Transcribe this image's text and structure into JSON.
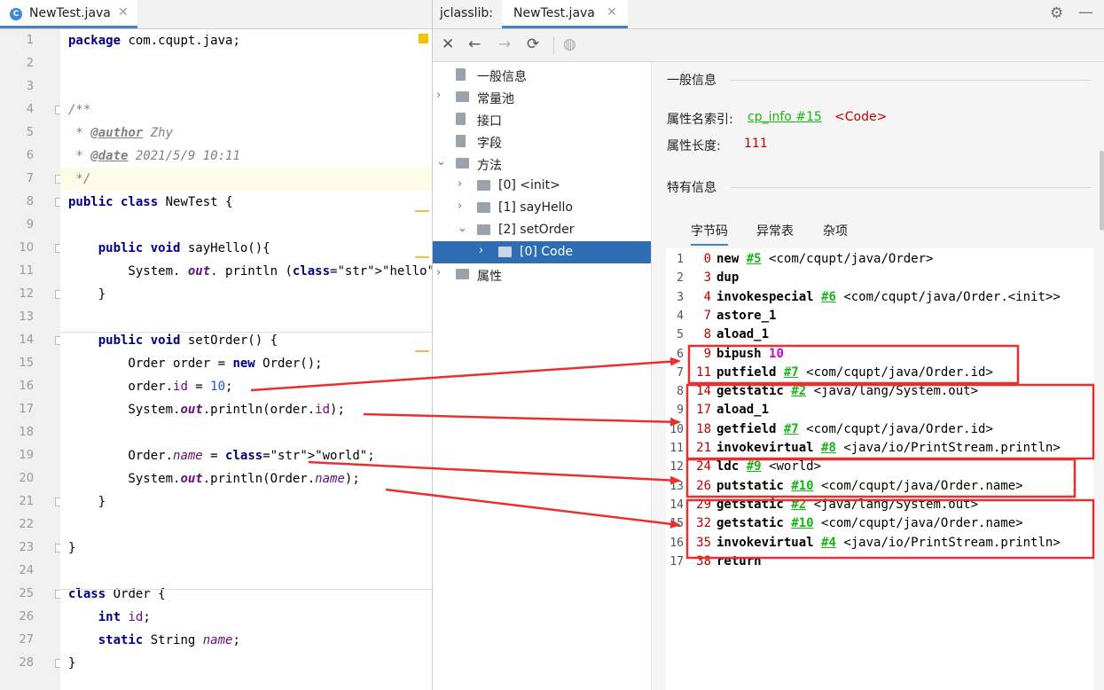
{
  "editor": {
    "tab_title": "NewTest.java",
    "tab_icon_letter": "C",
    "lines": [
      {
        "n": "1",
        "t": "package com.cqupt.java;"
      },
      {
        "n": "2",
        "t": ""
      },
      {
        "n": "3",
        "t": ""
      },
      {
        "n": "4",
        "t": "/**"
      },
      {
        "n": "5",
        "t": " * @author Zhy"
      },
      {
        "n": "6",
        "t": " * @date 2021/5/9 10:11"
      },
      {
        "n": "7",
        "t": " */"
      },
      {
        "n": "8",
        "t": "public class NewTest {"
      },
      {
        "n": "9",
        "t": ""
      },
      {
        "n": "10",
        "t": "    public void sayHello(){"
      },
      {
        "n": "11",
        "t": "        System. out. println (\"hello\");"
      },
      {
        "n": "12",
        "t": "    }"
      },
      {
        "n": "13",
        "t": ""
      },
      {
        "n": "14",
        "t": "    public void setOrder() {"
      },
      {
        "n": "15",
        "t": "        Order order = new Order();"
      },
      {
        "n": "16",
        "t": "        order.id = 10;"
      },
      {
        "n": "17",
        "t": "        System.out.println(order.id);"
      },
      {
        "n": "18",
        "t": ""
      },
      {
        "n": "19",
        "t": "        Order.name = \"world\";"
      },
      {
        "n": "20",
        "t": "        System.out.println(Order.name);"
      },
      {
        "n": "21",
        "t": "    }"
      },
      {
        "n": "22",
        "t": ""
      },
      {
        "n": "23",
        "t": "}"
      },
      {
        "n": "24",
        "t": ""
      },
      {
        "n": "25",
        "t": "class Order {"
      },
      {
        "n": "26",
        "t": "    int id;"
      },
      {
        "n": "27",
        "t": "    static String name;"
      },
      {
        "n": "28",
        "t": "}"
      }
    ]
  },
  "viewer": {
    "label": "jclasslib:",
    "tab_title": "NewTest.java",
    "tree": [
      {
        "label": "一般信息",
        "level": 0,
        "chevron": "",
        "icon": "page"
      },
      {
        "label": "常量池",
        "level": 0,
        "chevron": "›",
        "icon": "folder"
      },
      {
        "label": "接口",
        "level": 0,
        "chevron": "",
        "icon": "page"
      },
      {
        "label": "字段",
        "level": 0,
        "chevron": "",
        "icon": "page"
      },
      {
        "label": "方法",
        "level": 0,
        "chevron": "⌄",
        "icon": "folder"
      },
      {
        "label": "[0] <init>",
        "level": 1,
        "chevron": "›",
        "icon": "folder"
      },
      {
        "label": "[1] sayHello",
        "level": 1,
        "chevron": "›",
        "icon": "folder"
      },
      {
        "label": "[2] setOrder",
        "level": 1,
        "chevron": "⌄",
        "icon": "folder"
      },
      {
        "label": "[0] Code",
        "level": 2,
        "chevron": "›",
        "icon": "folder",
        "selected": true
      },
      {
        "label": "属性",
        "level": 0,
        "chevron": "›",
        "icon": "folder"
      }
    ],
    "detail": {
      "general_title": "一般信息",
      "attr_name_label": "属性名索引:",
      "attr_name_link": "cp_info #15",
      "attr_name_value": "<Code>",
      "attr_len_label": "属性长度:",
      "attr_len_value": "111",
      "specific_title": "特有信息",
      "tabs": [
        "字节码",
        "异常表",
        "杂项"
      ]
    },
    "bytecode": [
      {
        "n": "1",
        "off": "0",
        "ins": "new",
        "ref": "#5",
        "sym": "<com/cqupt/java/Order>"
      },
      {
        "n": "2",
        "off": "3",
        "ins": "dup",
        "ref": "",
        "sym": ""
      },
      {
        "n": "3",
        "off": "4",
        "ins": "invokespecial",
        "ref": "#6",
        "sym": "<com/cqupt/java/Order.<init>>"
      },
      {
        "n": "4",
        "off": "7",
        "ins": "astore_1",
        "ref": "",
        "sym": ""
      },
      {
        "n": "5",
        "off": "8",
        "ins": "aload_1",
        "ref": "",
        "sym": ""
      },
      {
        "n": "6",
        "off": "9",
        "ins": "bipush",
        "num": "10",
        "ref": "",
        "sym": ""
      },
      {
        "n": "7",
        "off": "11",
        "ins": "putfield",
        "ref": "#7",
        "sym": "<com/cqupt/java/Order.id>"
      },
      {
        "n": "8",
        "off": "14",
        "ins": "getstatic",
        "ref": "#2",
        "sym": "<java/lang/System.out>"
      },
      {
        "n": "9",
        "off": "17",
        "ins": "aload_1",
        "ref": "",
        "sym": ""
      },
      {
        "n": "10",
        "off": "18",
        "ins": "getfield",
        "ref": "#7",
        "sym": "<com/cqupt/java/Order.id>"
      },
      {
        "n": "11",
        "off": "21",
        "ins": "invokevirtual",
        "ref": "#8",
        "sym": "<java/io/PrintStream.println>"
      },
      {
        "n": "12",
        "off": "24",
        "ins": "ldc",
        "ref": "#9",
        "sym": "<world>"
      },
      {
        "n": "13",
        "off": "26",
        "ins": "putstatic",
        "ref": "#10",
        "sym": "<com/cqupt/java/Order.name>"
      },
      {
        "n": "14",
        "off": "29",
        "ins": "getstatic",
        "ref": "#2",
        "sym": "<java/lang/System.out>"
      },
      {
        "n": "15",
        "off": "32",
        "ins": "getstatic",
        "ref": "#10",
        "sym": "<com/cqupt/java/Order.name>"
      },
      {
        "n": "16",
        "off": "35",
        "ins": "invokevirtual",
        "ref": "#4",
        "sym": "<java/io/PrintStream.println>"
      },
      {
        "n": "17",
        "off": "38",
        "ins": "return",
        "ref": "",
        "sym": ""
      }
    ]
  },
  "colors": {
    "annotation_red": "#e8312f",
    "selection_blue": "#2f6db3",
    "link_green": "#18b418"
  }
}
